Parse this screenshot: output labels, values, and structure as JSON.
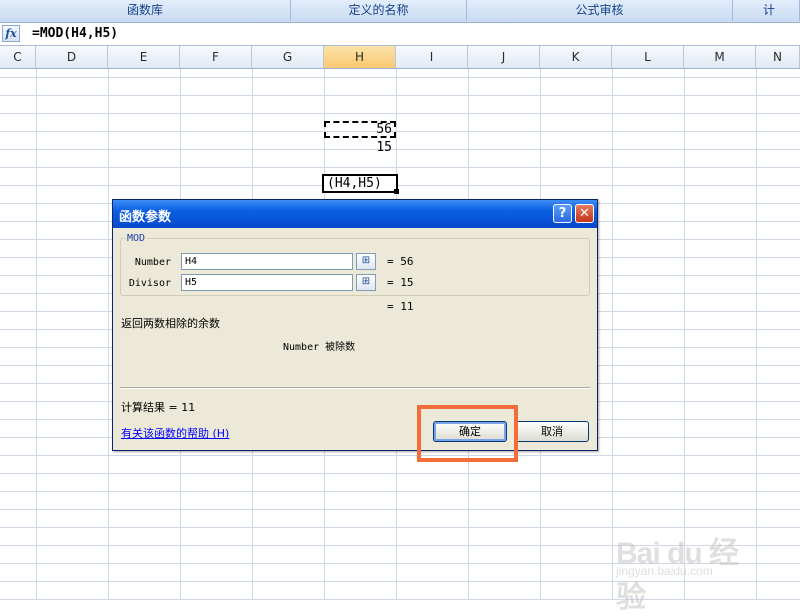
{
  "ribbon": {
    "groups": [
      "函数库",
      "定义的名称",
      "公式审核",
      "计"
    ]
  },
  "formula_bar": {
    "fx_icon": "fx-icon",
    "formula": "=MOD(H4,H5)"
  },
  "columns": [
    "C",
    "D",
    "E",
    "F",
    "G",
    "H",
    "I",
    "J",
    "K",
    "L",
    "M",
    "N"
  ],
  "selected_column": "H",
  "cells": {
    "H4": "56",
    "H5": "15",
    "H6": "(H4,H5)"
  },
  "dialog": {
    "title": "函数参数",
    "help_symbol": "?",
    "close_symbol": "✕",
    "function_name": "MOD",
    "arguments": [
      {
        "label": "Number",
        "value": "H4",
        "result": "= 56"
      },
      {
        "label": "Divisor",
        "value": "H5",
        "result": "= 15"
      }
    ],
    "formula_result": "= 11",
    "description": "返回两数相除的余数",
    "arg_description_name": "Number",
    "arg_description_text": "被除数",
    "calc_result": "计算结果 = 11",
    "help_link": "有关该函数的帮助 (H)",
    "ok_label": "确定",
    "cancel_label": "取消"
  },
  "watermark": {
    "logo": "Bai du 经验",
    "url": "jingyan.baidu.com"
  },
  "colors": {
    "highlight": "#f36d3a",
    "title_bar": "#0a5ee2",
    "dialog_bg": "#ece9d8"
  }
}
